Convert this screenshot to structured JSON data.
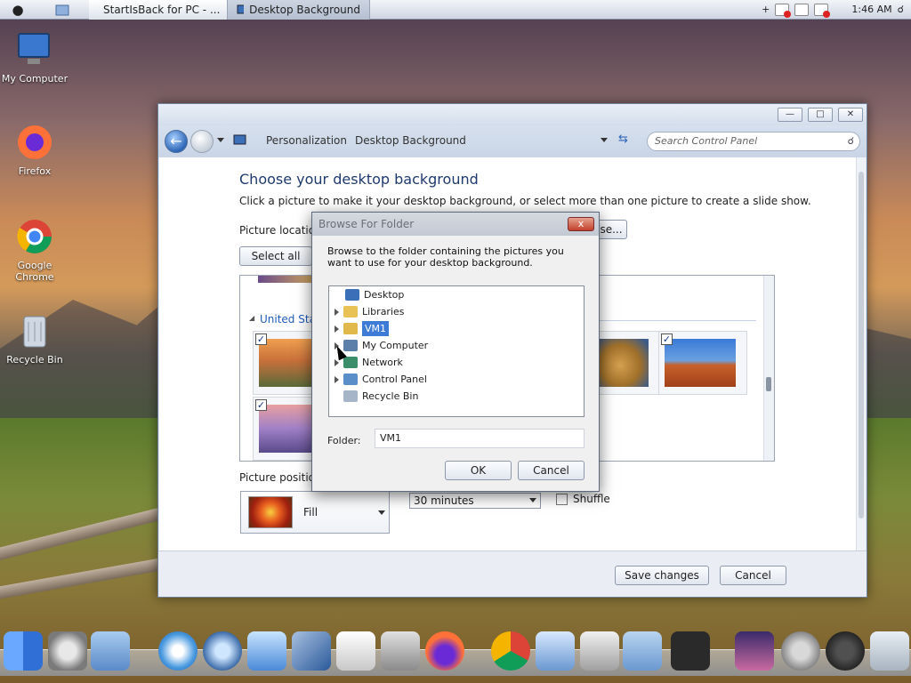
{
  "menubar": {
    "tabs": [
      {
        "label": "StartIsBack for PC - ..."
      },
      {
        "label": "Desktop Background"
      }
    ],
    "add_label": "+",
    "clock": "1:46 AM"
  },
  "desktop": {
    "icons": [
      {
        "label": "My Computer"
      },
      {
        "label": "Firefox"
      },
      {
        "label": "Google Chrome"
      },
      {
        "label": "Recycle Bin"
      }
    ]
  },
  "window": {
    "breadcrumb": [
      "Personalization",
      "Desktop Background"
    ],
    "search_placeholder": "Search Control Panel",
    "heading": "Choose your desktop background",
    "description": "Click a picture to make it your desktop background, or select more than one picture to create a slide show.",
    "picture_location_label": "Picture location:",
    "browse_label": "Browse...",
    "select_all_label": "Select all",
    "group_label": "United States",
    "picture_position_label": "Picture position:",
    "fill_label": "Fill",
    "interval_value": "30 minutes",
    "shuffle_label": "Shuffle",
    "save_label": "Save changes",
    "cancel_label": "Cancel"
  },
  "dialog": {
    "title": "Browse For Folder",
    "close_label": "x",
    "description": "Browse to the folder containing the pictures you want to use for your desktop background.",
    "tree": [
      {
        "label": "Desktop",
        "color": "#3b6fb8"
      },
      {
        "label": "Libraries",
        "color": "#e8c254"
      },
      {
        "label": "VM1",
        "color": "#e1b94a"
      },
      {
        "label": "My Computer",
        "color": "#5b7fa8"
      },
      {
        "label": "Network",
        "color": "#3a8f6a"
      },
      {
        "label": "Control Panel",
        "color": "#5a8ec8"
      },
      {
        "label": "Recycle Bin",
        "color": "#a6b6c8"
      }
    ],
    "folder_label": "Folder:",
    "folder_value": "VM1",
    "ok_label": "OK",
    "cancel_label": "Cancel"
  },
  "colors": {
    "accent": "#3d7bd6",
    "heading": "#1f3a6e",
    "group": "#1f5cb8"
  }
}
